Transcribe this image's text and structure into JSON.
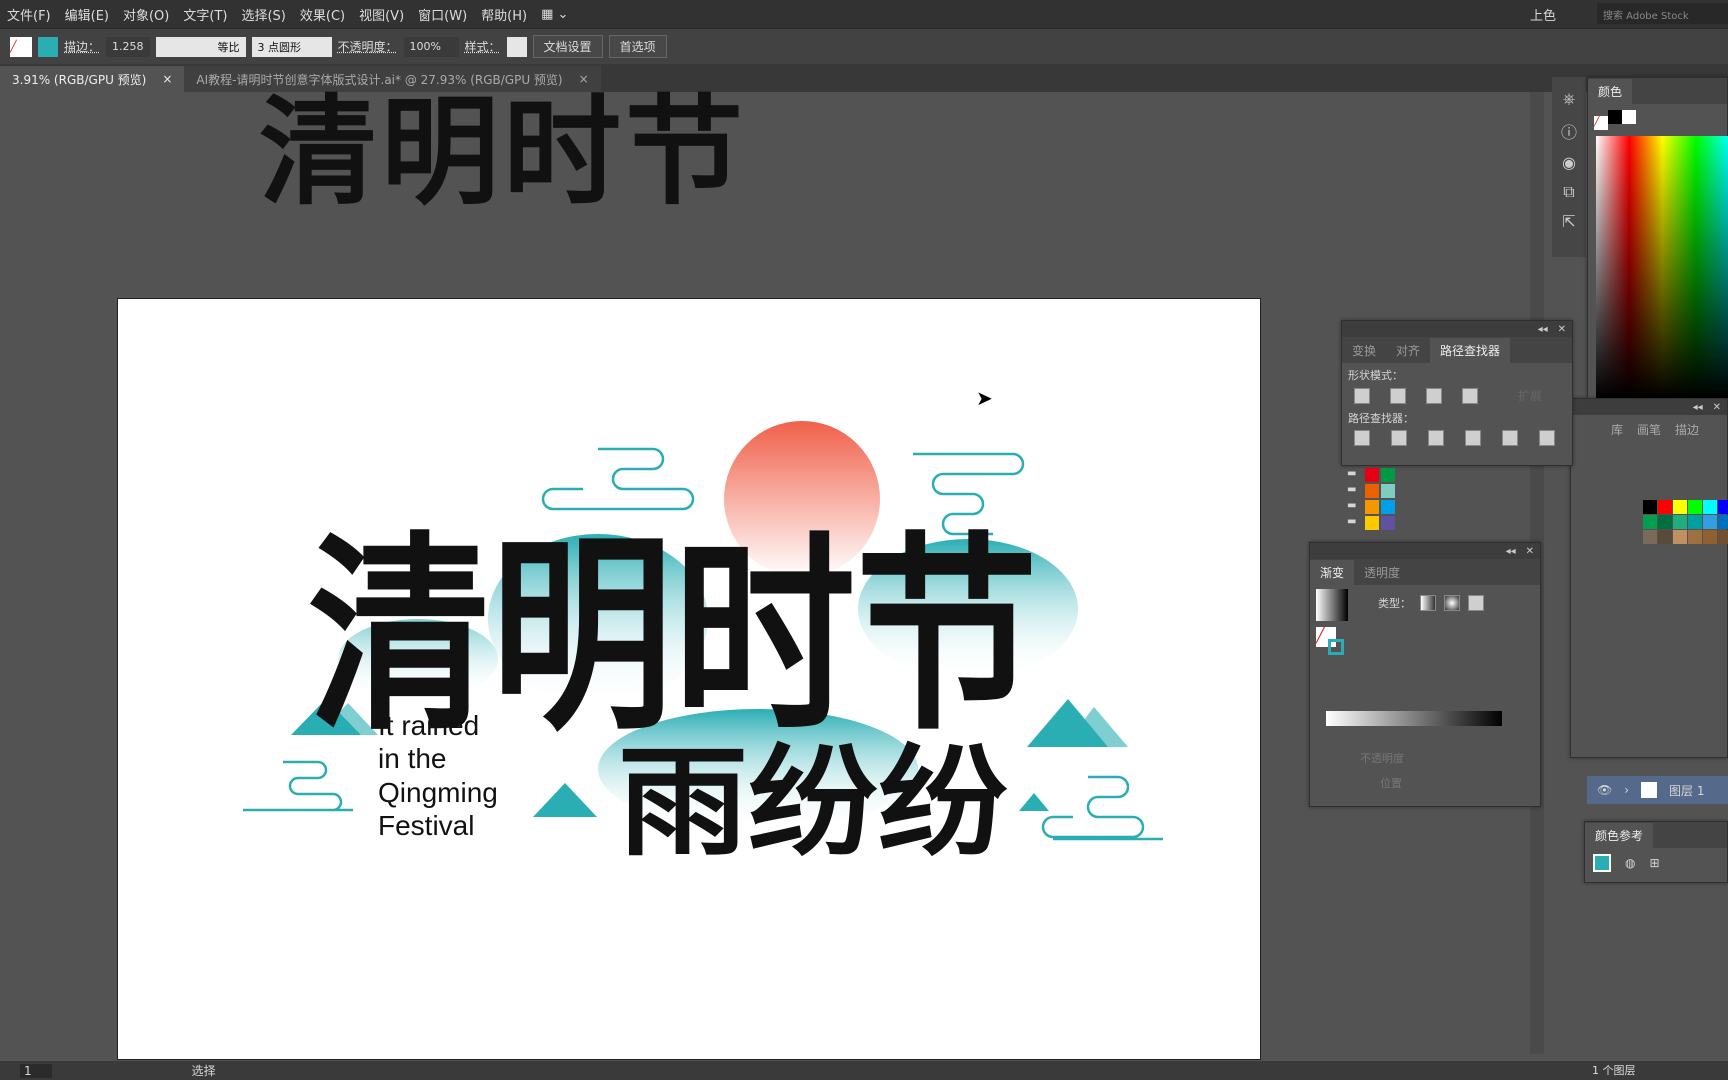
{
  "menu": [
    "文件(F)",
    "编辑(E)",
    "对象(O)",
    "文字(T)",
    "选择(S)",
    "效果(C)",
    "视图(V)",
    "窗口(W)",
    "帮助(H)"
  ],
  "workspace": "上色",
  "search_placeholder": "搜索 Adobe Stock",
  "control": {
    "stroke_label": "描边：",
    "stroke_value": "1.258",
    "stroke_profile": "等比",
    "brush": "3 点圆形",
    "opacity_label": "不透明度：",
    "opacity_value": "100%",
    "style_label": "样式：",
    "doc_setup": "文档设置",
    "preferences": "首选项"
  },
  "tabs": [
    {
      "label": "3.91% (RGB/GPU 预览)",
      "active": true
    },
    {
      "label": "AI教程-请明时节创意字体版式设计.ai* @ 27.93% (RGB/GPU 预览)",
      "active": false
    }
  ],
  "artwork": {
    "top_title": "清明时节",
    "main_title": "清明时节",
    "subtitle": "雨纷纷",
    "english": [
      "It rained",
      "in the",
      "Qingming",
      "Festival"
    ]
  },
  "colors": {
    "teal": "#2aaeb4",
    "sun": "#f0604a",
    "canvas": "#535353"
  },
  "color_panel": {
    "title": "颜色"
  },
  "pathfinder": {
    "tabs": [
      "变换",
      "对齐",
      "路径查找器"
    ],
    "shape_modes": "形状模式：",
    "expand": "扩展",
    "pathfinders": "路径查找器："
  },
  "swatch_panel": {
    "tabs": [
      "库",
      "画笔",
      "描边"
    ]
  },
  "gradient": {
    "tabs": [
      "渐变",
      "透明度"
    ],
    "type_label": "类型：",
    "opacity_label": "不透明度",
    "position_label": "位置"
  },
  "layers": {
    "layer_name": "图层 1",
    "count": "1 个图层"
  },
  "color_guide": {
    "title": "颜色参考"
  },
  "status": {
    "zoom_page": "1",
    "tool": "选择"
  }
}
